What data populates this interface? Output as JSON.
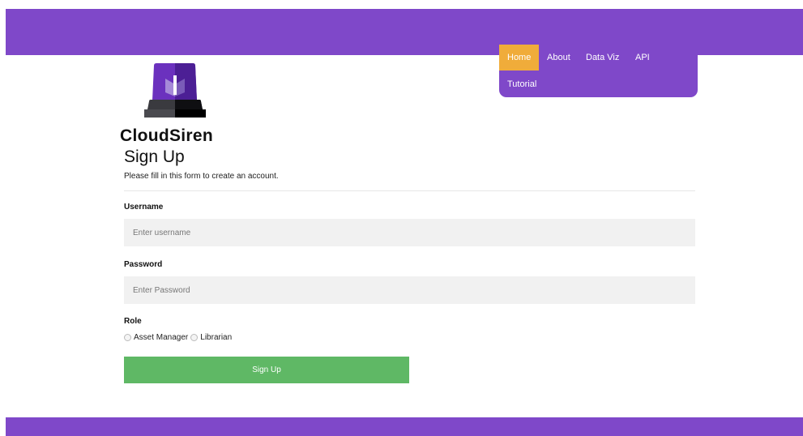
{
  "colors": {
    "brand_purple": "#7f48c9",
    "nav_active": "#f0ac3a",
    "button_green": "#5fb865",
    "input_background": "#f1f1f1"
  },
  "nav": {
    "items": [
      {
        "label": "Home",
        "active": true
      },
      {
        "label": "About",
        "active": false
      },
      {
        "label": "Data Viz",
        "active": false
      },
      {
        "label": "API",
        "active": false
      },
      {
        "label": "Tutorial",
        "active": false
      }
    ]
  },
  "brand": {
    "logo_icon": "siren-icon",
    "name": "CloudSiren"
  },
  "form": {
    "title": "Sign Up",
    "subtitle": "Please fill in this form to create an account.",
    "username": {
      "label": "Username",
      "placeholder": "Enter username",
      "value": ""
    },
    "password": {
      "label": "Password",
      "placeholder": "Enter Password",
      "value": ""
    },
    "role": {
      "label": "Role",
      "options": [
        "Asset Manager",
        "Librarian"
      ]
    },
    "submit_label": "Sign Up"
  }
}
